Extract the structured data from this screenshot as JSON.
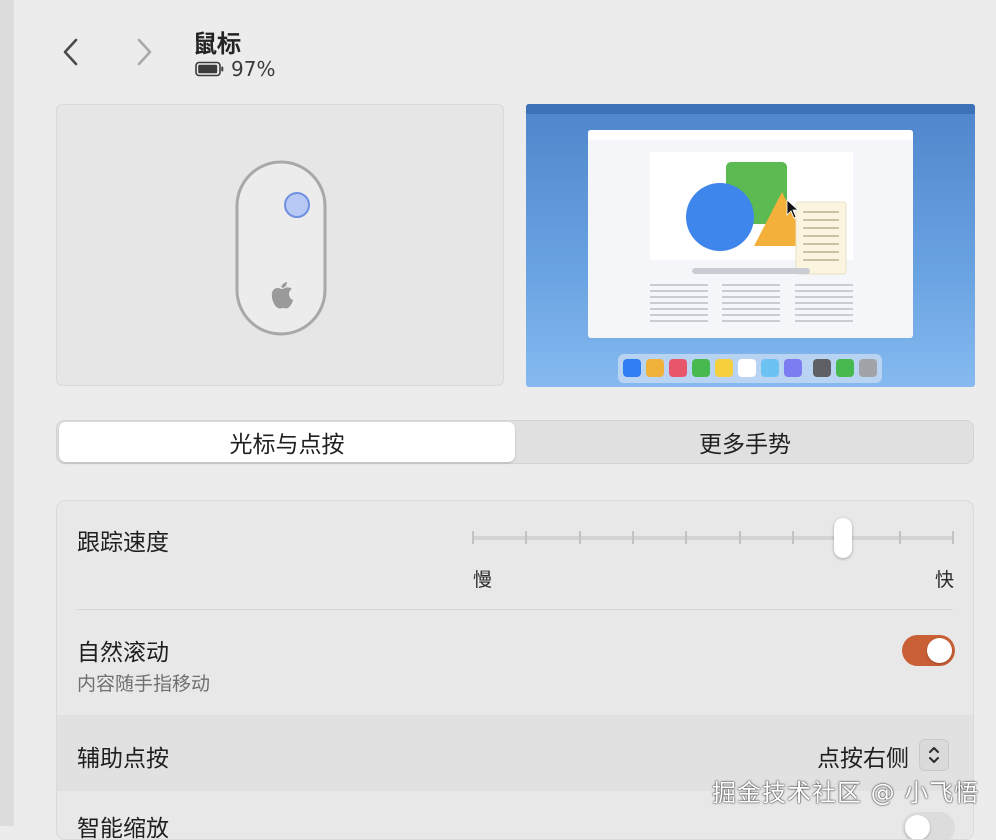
{
  "header": {
    "title": "鼠标",
    "battery_text": "97%",
    "battery_fraction": 0.97,
    "back_icon": "chevron-left-icon",
    "forward_icon": "chevron-right-icon"
  },
  "tabs": [
    {
      "label": "光标与点按",
      "selected": true
    },
    {
      "label": "更多手势",
      "selected": false
    }
  ],
  "settings": {
    "tracking_speed": {
      "label": "跟踪速度",
      "min_label": "慢",
      "max_label": "快",
      "value_fraction": 0.77,
      "tick_count": 10
    },
    "natural_scrolling": {
      "label": "自然滚动",
      "description": "内容随手指移动",
      "enabled": true,
      "color": "#c95f34"
    },
    "secondary_click": {
      "label": "辅助点按",
      "value": "点按右侧"
    },
    "smart_zoom": {
      "label": "智能缩放",
      "enabled": false
    }
  },
  "watermark": "掘金技术社区 @ 小飞悟"
}
